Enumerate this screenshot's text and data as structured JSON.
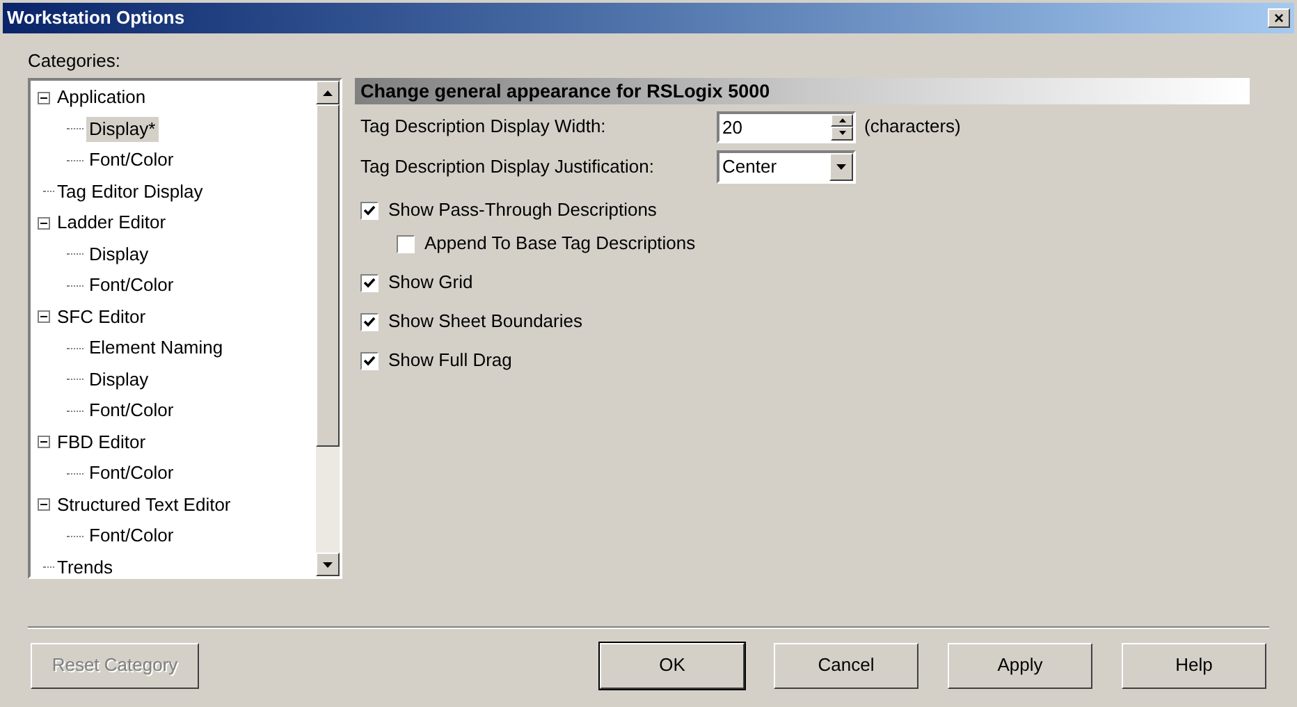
{
  "window": {
    "title": "Workstation Options",
    "close": "×"
  },
  "categories": {
    "label": "Categories:",
    "items": [
      {
        "label": "Application",
        "expanded": true,
        "selected": false,
        "children": [
          {
            "label": "Display*",
            "selected": true
          },
          {
            "label": "Font/Color",
            "selected": false
          }
        ]
      },
      {
        "label": "Tag Editor Display",
        "selected": false
      },
      {
        "label": "Ladder Editor",
        "expanded": true,
        "selected": false,
        "children": [
          {
            "label": "Display",
            "selected": false
          },
          {
            "label": "Font/Color",
            "selected": false
          }
        ]
      },
      {
        "label": "SFC Editor",
        "expanded": true,
        "selected": false,
        "children": [
          {
            "label": "Element Naming",
            "selected": false
          },
          {
            "label": "Display",
            "selected": false
          },
          {
            "label": "Font/Color",
            "selected": false
          }
        ]
      },
      {
        "label": "FBD Editor",
        "expanded": true,
        "selected": false,
        "children": [
          {
            "label": "Font/Color",
            "selected": false
          }
        ]
      },
      {
        "label": "Structured Text Editor",
        "expanded": true,
        "selected": false,
        "children": [
          {
            "label": "Font/Color",
            "selected": false
          }
        ]
      },
      {
        "label": "Trends",
        "selected": false
      }
    ]
  },
  "panel": {
    "heading": "Change general appearance for RSLogix 5000",
    "width": {
      "label": "Tag Description Display Width:",
      "value": "20",
      "unit": "(characters)"
    },
    "justification": {
      "label": "Tag Description Display Justification:",
      "value": "Center"
    },
    "options": [
      {
        "label": "Show Pass-Through Descriptions",
        "checked": true,
        "children": [
          {
            "label": "Append To Base Tag Descriptions",
            "checked": false
          }
        ]
      },
      {
        "label": "Show Grid",
        "checked": true
      },
      {
        "label": "Show Sheet Boundaries",
        "checked": true
      },
      {
        "label": "Show Full Drag",
        "checked": true
      }
    ]
  },
  "buttons": [
    {
      "label": "Reset Category",
      "disabled": true,
      "default": false
    },
    {
      "label": "OK",
      "disabled": false,
      "default": true
    },
    {
      "label": "Cancel",
      "disabled": false,
      "default": false
    },
    {
      "label": "Apply",
      "disabled": false,
      "default": false
    },
    {
      "label": "Help",
      "disabled": false,
      "default": false
    }
  ]
}
